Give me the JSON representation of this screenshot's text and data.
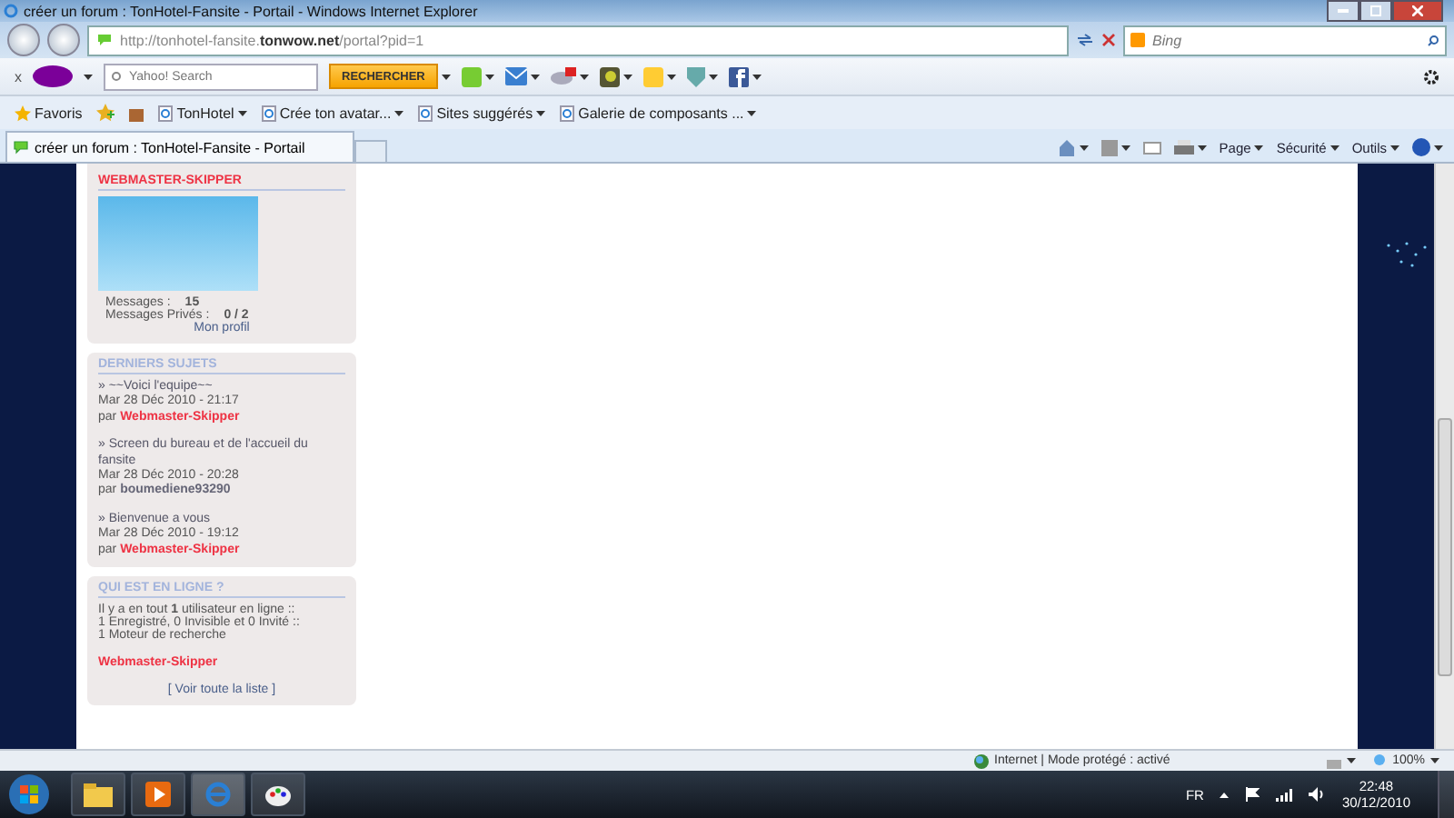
{
  "window": {
    "title": "créer un forum : TonHotel-Fansite - Portail - Windows Internet Explorer"
  },
  "address_bar": {
    "url": "http://tonhotel-fansite.**tonwow.net**/portal?pid=1"
  },
  "search_box": {
    "placeholder": "Bing"
  },
  "yahoo_toolbar": {
    "close": "x",
    "search_placeholder": "Yahoo! Search",
    "search_button": "RECHERCHER"
  },
  "favorites_bar": {
    "favorites": "Favoris",
    "links": [
      "TonHotel",
      "Crée ton avatar...",
      "Sites suggérés",
      "Galerie de composants ..."
    ]
  },
  "tabs": [
    {
      "label": "créer un forum : TonHotel-Fansite - Portail",
      "selected": true
    }
  ],
  "command_bar": [
    "Page",
    "Sécurité",
    "Outils"
  ],
  "profile": {
    "username": "WEBMASTER-SKIPPER",
    "stats": [
      {
        "label": "Messages :",
        "value": "15"
      },
      {
        "label": "Messages Privés :",
        "value": "0 / 2"
      }
    ],
    "link": "Mon profil"
  },
  "recent_topics": {
    "title": "DERNIERS SUJETS",
    "items": [
      {
        "title": "» ~~Voici l'equipe~~",
        "date": "Mar 28 Déc 2010 - 21:17",
        "by": "par",
        "author": "Webmaster-Skipper",
        "color": "#ee3344"
      },
      {
        "title": "» Screen du bureau et de l'accueil du fansite",
        "date": "Mar 28 Déc 2010 - 20:28",
        "by": "par",
        "author": "boumediene93290",
        "color": "#666677"
      },
      {
        "title": "» Bienvenue a vous",
        "date": "Mar 28 Déc 2010 - 19:12",
        "by": "par",
        "author": "Webmaster-Skipper",
        "color": "#ee3344"
      }
    ]
  },
  "online": {
    "title": "QUI EST EN LIGNE ?",
    "lines": [
      "Il y a en tout **1** utilisateur en ligne ::",
      "1 Enregistré, 0 Invisible et 0 Invité ::",
      "1 Moteur de recherche"
    ],
    "users": [
      "Webmaster-Skipper"
    ],
    "link": "[ Voir toute la liste ]"
  },
  "status_bar": {
    "zone": "Internet | Mode protégé : activé",
    "zoom": "100%"
  },
  "taskbar": {
    "language": "FR",
    "time": "22:48",
    "date": "30/12/2010"
  }
}
